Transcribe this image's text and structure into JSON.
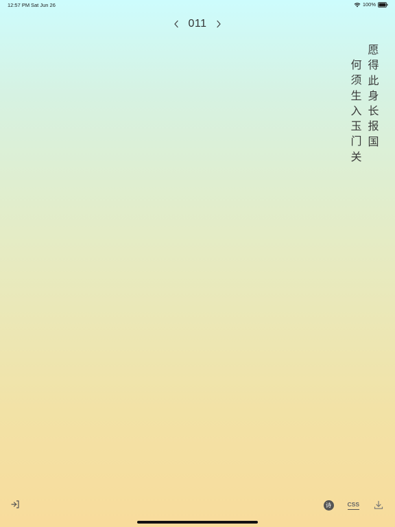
{
  "status_bar": {
    "time": "12:57 PM",
    "date": "Sat Jun 26",
    "battery": "100%",
    "icons": [
      "wifi-icon",
      "battery-icon"
    ]
  },
  "nav": {
    "number": "011",
    "prev_icon": "chevron-left-icon",
    "next_icon": "chevron-right-icon"
  },
  "poem": {
    "lines": [
      [
        "愿",
        "得",
        "此",
        "身",
        "长",
        "报",
        "国"
      ],
      [
        "何",
        "须",
        "生",
        "入",
        "玉",
        "门",
        "关"
      ]
    ]
  },
  "toolbar": {
    "exit_icon": "exit-icon",
    "poem_badge": "诗",
    "css_label": "CSS",
    "download_icon": "download-icon"
  },
  "colors": {
    "gradient_top": "#cdfcfd",
    "gradient_bottom": "#f8dc9c",
    "text": "#3a3a3a"
  }
}
